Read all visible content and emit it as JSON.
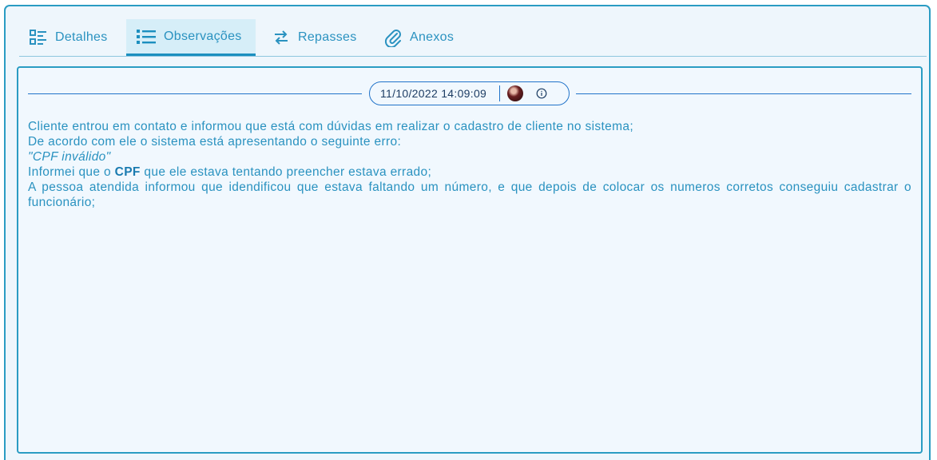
{
  "tabs": [
    {
      "label": "Detalhes",
      "icon": "list-details-icon"
    },
    {
      "label": "Observações",
      "icon": "list-bullets-icon",
      "active": true
    },
    {
      "label": "Repasses",
      "icon": "swap-arrows-icon"
    },
    {
      "label": "Anexos",
      "icon": "paperclip-icon"
    }
  ],
  "observation": {
    "timestamp": "11/10/2022 14:09:09",
    "avatar": "user-avatar",
    "info_icon": "info-icon",
    "lines": {
      "line1": "Cliente entrou em contato e informou que está com dúvidas em realizar o cadastro de cliente no sistema;",
      "line2": "De acordo com ele o sistema está apresentando o seguinte erro:",
      "line3": "\"CPF inválido\"",
      "line4_before": "Informei que o ",
      "line4_bold": "CPF",
      "line4_after": " que ele estava tentando preencher estava errado;",
      "line5": "A pessoa atendida informou que idendificou que estava faltando um número, e que depois de colocar os numeros corretos conseguiu cadastrar o funcionário;"
    }
  },
  "colors": {
    "accent": "#2a92c0",
    "border": "#2a9cc3",
    "divider": "#2173c9",
    "background": "#eef6fc"
  }
}
